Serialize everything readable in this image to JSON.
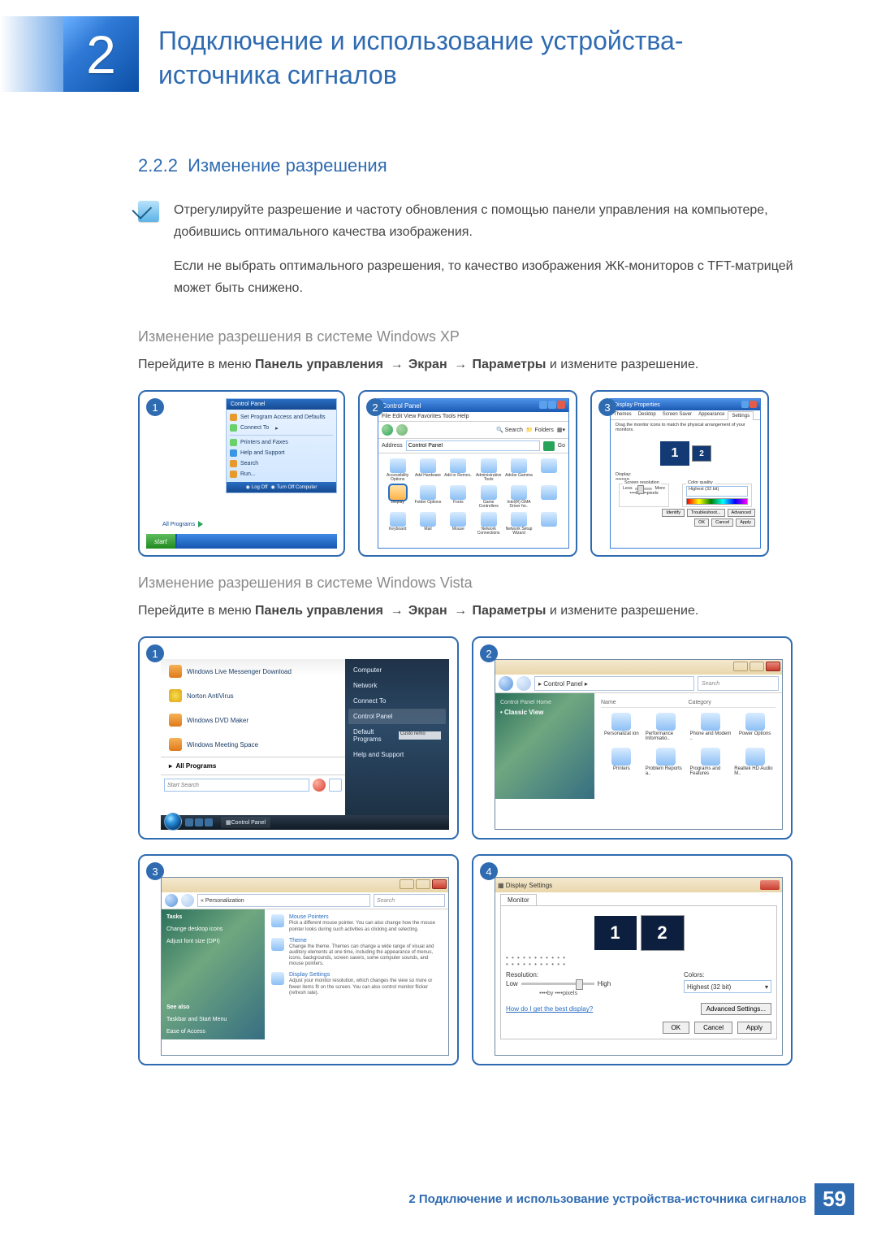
{
  "chapter": {
    "number": "2",
    "title": "Подключение и использование устройства-источника сигналов"
  },
  "section": {
    "number": "2.2.2",
    "title": "Изменение разрешения"
  },
  "note": {
    "p1": "Отрегулируйте разрешение и частоту обновления с помощью панели управления на компьютере, добившись оптимального качества изображения.",
    "p2": "Если не выбрать оптимального разрешения, то качество изображения ЖК-мониторов с TFT-матрицей может быть снижено."
  },
  "xp": {
    "heading": "Изменение разрешения в системе Windows XP",
    "path_prefix": "Перейдите в меню ",
    "path_cp": "Панель управления",
    "path_display": "Экран",
    "path_settings": "Параметры",
    "path_suffix": " и измените разрешение.",
    "arrow": "→",
    "shots": {
      "1": {
        "badge": "1",
        "start_label": "start",
        "all_programs": "All Programs",
        "menu_head": "Control Panel",
        "menu": [
          "Set Program Access and Defaults",
          "Connect To",
          "Printers and Faxes",
          "Help and Support",
          "Search",
          "Run..."
        ],
        "logoff": "Log Off",
        "turnoff": "Turn Off Computer"
      },
      "2": {
        "badge": "2",
        "title": "Control Panel",
        "menus": "File  Edit  View  Favorites  Tools  Help",
        "search": "Search",
        "folders": "Folders",
        "address_label": "Address",
        "address_value": "Control Panel",
        "go": "Go",
        "icons": [
          "Accessibility Options",
          "Add Hardware",
          "Add or Remov..",
          "Administrative Tools",
          "Adobe Gamma",
          "",
          "Display",
          "Folder Options",
          "Fonts",
          "Game Controllers",
          "Intel(R) GMA Driver for..",
          "",
          "Keyboard",
          "Mail",
          "Mouse",
          "Network Connections",
          "Network Setup Wizard",
          ""
        ]
      },
      "3": {
        "badge": "3",
        "title": "Display Properties",
        "tabs": [
          "Themes",
          "Desktop",
          "Screen Saver",
          "Appearance",
          "Settings"
        ],
        "hint": "Drag the monitor icons to match the physical arrangement of your monitors.",
        "mon1": "1",
        "mon2": "2",
        "display_label": "Display:",
        "display_value": "•••••••••",
        "res_group": "Screen resolution",
        "less": "Less",
        "more": "More",
        "res_text": "••••by••••pixels",
        "color_group": "Color quality",
        "color_value": "Highest (32 bit)",
        "identify": "Identify",
        "troubleshoot": "Troubleshoot...",
        "advanced": "Advanced",
        "ok": "OK",
        "cancel": "Cancel",
        "apply": "Apply"
      }
    }
  },
  "vista": {
    "heading": "Изменение разрешения в системе Windows Vista",
    "shots": {
      "1": {
        "badge": "1",
        "left_items": [
          "Windows Live Messenger Download",
          "Norton AntiVirus",
          "Windows DVD Maker",
          "Windows Meeting Space"
        ],
        "all_programs": "All Programs",
        "search_placeholder": "Start Search",
        "right_items": [
          "Computer",
          "Network",
          "Connect To",
          "Control Panel",
          "Default Programs",
          "Help and Support"
        ],
        "right_extra": "Custo remo",
        "task_btn": "Control Panel"
      },
      "2": {
        "badge": "2",
        "crumb": "▸ Control Panel ▸",
        "search": "Search",
        "side_head": "Control Panel Home",
        "side_item": "Classic View",
        "cols": [
          "Name",
          "Category"
        ],
        "icons": [
          "Personalizat ion",
          "Performance Informatio..",
          "Phone and Modem ..",
          "Power Options",
          "Printers",
          "Problem Reports a..",
          "Programs and Features",
          "Realtek HD Audio M.."
        ]
      },
      "3": {
        "badge": "3",
        "crumb": "« Personalization",
        "search": "Search",
        "side": {
          "tasks": "Tasks",
          "l1": "Change desktop icons",
          "l2": "Adjust font size (DPI)",
          "see": "See also",
          "s1": "Taskbar and Start Menu",
          "s2": "Ease of Access"
        },
        "items": [
          {
            "title": "Mouse Pointers",
            "desc": "Pick a different mouse pointer. You can also change how the mouse pointer looks during such activities as clicking and selecting."
          },
          {
            "title": "Theme",
            "desc": "Change the theme. Themes can change a wide range of visual and auditory elements at one time, including the appearance of menus, icons, backgrounds, screen savers, some computer sounds, and mouse pointers."
          },
          {
            "title": "Display Settings",
            "desc": "Adjust your monitor resolution, which changes the view so more or fewer items fit on the screen. You can also control monitor flicker (refresh rate)."
          }
        ]
      },
      "4": {
        "badge": "4",
        "title": "Display Settings",
        "tab": "Monitor",
        "mon1": "1",
        "mon2": "2",
        "dots": "• • • • • • • • • • •",
        "res_label": "Resolution:",
        "low": "Low",
        "high": "High",
        "px": "••••by ••••pixels",
        "colors_label": "Colors:",
        "colors_value": "Highest (32 bit)",
        "link": "How do I get the best display?",
        "adv": "Advanced Settings...",
        "ok": "OK",
        "cancel": "Cancel",
        "apply": "Apply"
      }
    }
  },
  "footer": {
    "text": "2 Подключение и использование устройства-источника сигналов",
    "page": "59"
  }
}
